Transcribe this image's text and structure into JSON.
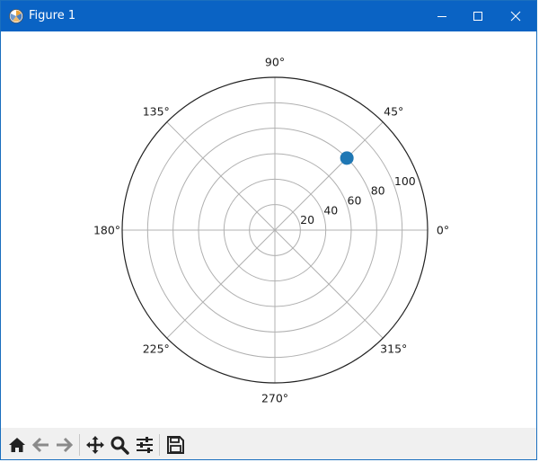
{
  "window": {
    "title": "Figure 1",
    "minimize_label": "minimize",
    "maximize_label": "maximize",
    "close_label": "close"
  },
  "toolbar": {
    "buttons": [
      {
        "name": "home-button",
        "icon": "home-icon",
        "tooltip": "Reset original view"
      },
      {
        "name": "back-button",
        "icon": "arrow-left-icon",
        "tooltip": "Back to previous view"
      },
      {
        "name": "forward-button",
        "icon": "arrow-right-icon",
        "tooltip": "Forward to next view"
      },
      {
        "name": "pan-button",
        "icon": "move-icon",
        "tooltip": "Pan axes"
      },
      {
        "name": "zoom-button",
        "icon": "magnifier-icon",
        "tooltip": "Zoom to rectangle"
      },
      {
        "name": "configure-button",
        "icon": "sliders-icon",
        "tooltip": "Configure subplots"
      },
      {
        "name": "save-button",
        "icon": "floppy-disk-icon",
        "tooltip": "Save the figure"
      }
    ]
  },
  "chart_data": {
    "type": "scatter",
    "projection": "polar",
    "theta_unit": "degrees",
    "series": [
      {
        "theta": [
          45
        ],
        "r": [
          80
        ],
        "color": "#1f77b4"
      }
    ],
    "rlim": [
      0,
      120
    ],
    "r_ticks": [
      20,
      40,
      60,
      80,
      100
    ],
    "r_tick_labels": [
      "20",
      "40",
      "60",
      "80",
      "100"
    ],
    "theta_ticks": [
      0,
      45,
      90,
      135,
      180,
      225,
      270,
      315
    ],
    "theta_tick_labels": [
      "0°",
      "45°",
      "90°",
      "135°",
      "180°",
      "225°",
      "270°",
      "315°"
    ],
    "r_label_angle": 22.5,
    "grid": true,
    "colors": {
      "grid": "#b0b0b0",
      "spine": "#222222",
      "marker": "#1f77b4"
    }
  }
}
